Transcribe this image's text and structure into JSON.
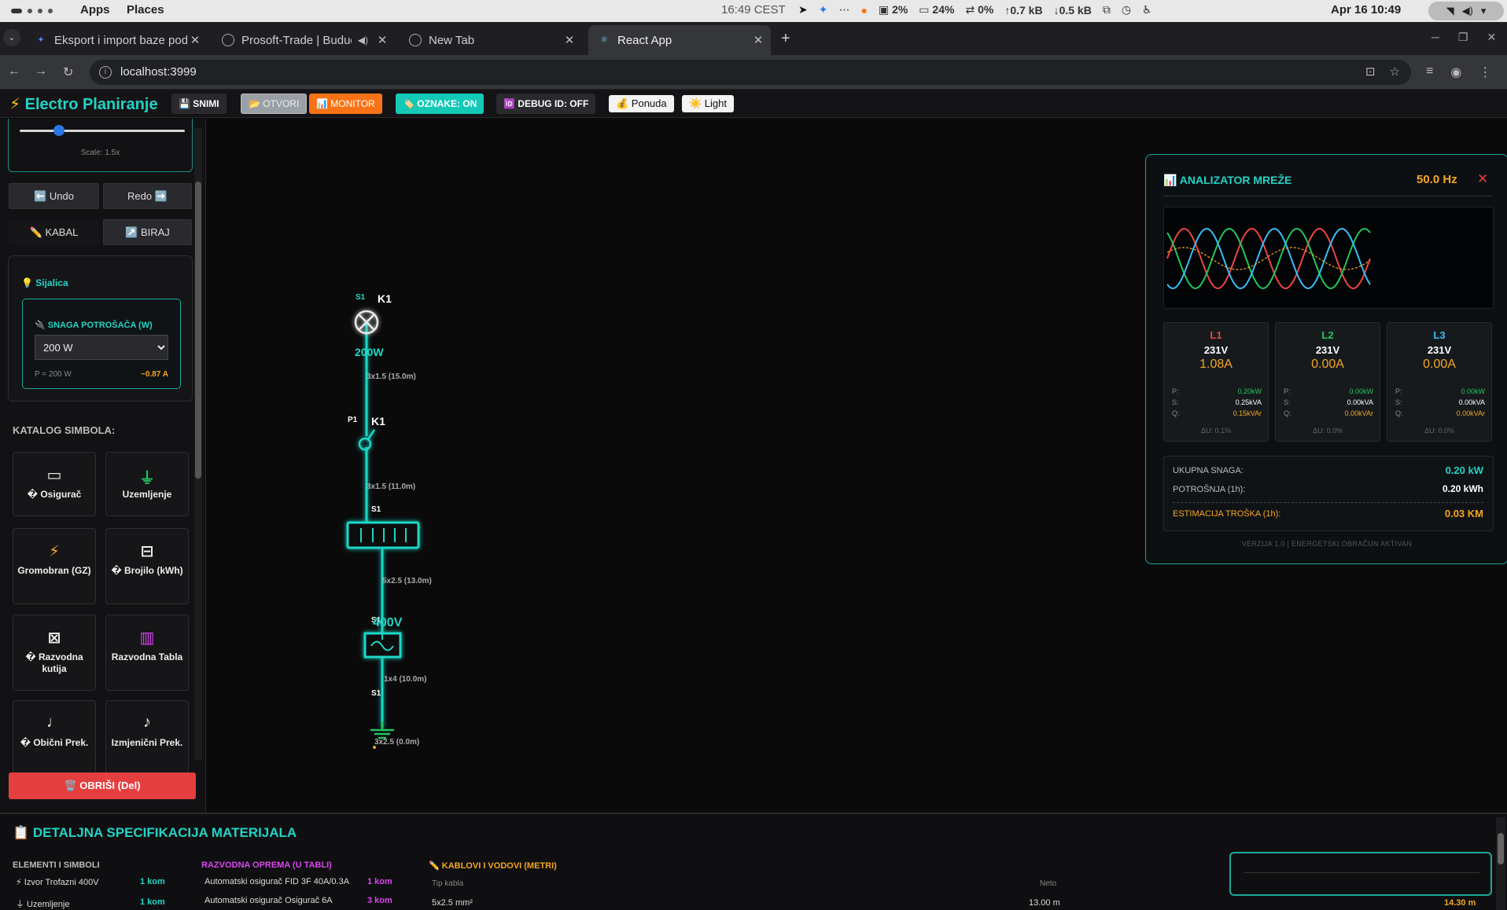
{
  "system": {
    "apps": "Apps",
    "places": "Places",
    "time_center": "16:49 CEST",
    "cpu": "2%",
    "mem": "24%",
    "swap": "0%",
    "net_up": "0.7 kB",
    "net_down": "0.5 kB",
    "datetime": "Apr 16  10:49"
  },
  "tabs": [
    {
      "title": "Eksport i import baze podataka",
      "icon_color": "#4a8af4",
      "icon": "sparkle-icon"
    },
    {
      "title": "Prosoft-Trade | Budući",
      "icon_color": "#888",
      "icon": "globe-icon"
    },
    {
      "title": "New Tab",
      "icon_color": "#888",
      "icon": "chrome-icon"
    },
    {
      "title": "React App",
      "icon_color": "#61dafb",
      "icon": "react-icon"
    }
  ],
  "address": {
    "url": "localhost:3999"
  },
  "app": {
    "brand": "Electro Planiranje",
    "toolbar": {
      "save": "💾 SNIMI",
      "open": "📂 OTVORI",
      "monitor": "📊 MONITOR",
      "labels": "🏷️ OZNAKE: ON",
      "debug": "🆔 DEBUG ID: OFF",
      "offer": "💰 Ponuda",
      "theme": "☀️ Light"
    },
    "accent": "#22d3c5"
  },
  "sidebar": {
    "scale_label": "Scale: 1.5x",
    "undo": "⬅️ Undo",
    "redo": "Redo ➡️",
    "cable": "✏️ KABAL",
    "select": "↗️ BIRAJ",
    "props": {
      "title": "💡 Sijalica",
      "power_label": "🔌 SNAGA POTROŠAČA (W)",
      "power_value": "200 W",
      "p_readout": "P = 200 W",
      "i_readout": "~0.87 A"
    },
    "catalog_title": "KATALOG SIMBOLA:",
    "catalog": [
      {
        "name": "� Osigurač",
        "sym": "▭",
        "color": "#fff"
      },
      {
        "name": "Uzemljenje",
        "sym": "⏚",
        "color": "#22c55e"
      },
      {
        "name": "Gromobran (GZ)",
        "sym": "⚡",
        "color": "#f5a623"
      },
      {
        "name": "� Brojilo (kWh)",
        "sym": "⊟",
        "color": "#fff"
      },
      {
        "name": "� Razvodna kutija",
        "sym": "⊠",
        "color": "#fff"
      },
      {
        "name": "Razvodna Tabla",
        "sym": "▥",
        "color": "#d946ef"
      },
      {
        "name": "� Obični Prek.",
        "sym": "♩",
        "color": "#fff"
      },
      {
        "name": "Izmjenični Prek.",
        "sym": "♪",
        "color": "#fff"
      }
    ],
    "delete": "🗑️ OBRIŠI (Del)"
  },
  "diagram": {
    "labels": {
      "s1_top": "S1",
      "k1_top": "K1",
      "power": "200W",
      "cable1": "3x1.5 (15.0m)",
      "p1": "P1",
      "k1_switch": "K1",
      "cable2": "3x1.5 (11.0m)",
      "s1_panel": "S1",
      "cable3": "5x2.5 (13.0m)",
      "s1_source": "S1",
      "source_v": "400V",
      "cable4": "1x4 (10.0m)",
      "s1_ground": "S1",
      "cable5": "3x2.5 (0.0m)"
    }
  },
  "analyzer": {
    "title": "📊 ANALIZATOR MREŽE",
    "freq": "50.0 Hz",
    "phases": [
      {
        "name": "L1",
        "color": "#ef4444",
        "v": "231V",
        "a": "1.08A",
        "p": "0.20kW",
        "s": "0.25kVA",
        "q": "0.15kVAr",
        "du": "ΔU: 0.1%"
      },
      {
        "name": "L2",
        "color": "#22c55e",
        "v": "231V",
        "a": "0.00A",
        "p": "0.00kW",
        "s": "0.00kVA",
        "q": "0.00kVAr",
        "du": "ΔU: 0.0%"
      },
      {
        "name": "L3",
        "color": "#38bdf8",
        "v": "231V",
        "a": "0.00A",
        "p": "0.00kW",
        "s": "0.00kVA",
        "q": "0.00kVAr",
        "du": "ΔU: 0.0%"
      }
    ],
    "row_labels": {
      "p": "P:",
      "s": "S:",
      "q": "Q:"
    },
    "total_label": "UKUPNA SNAGA:",
    "total_value": "0.20 kW",
    "consumption_label": "POTROŠNJA (1h):",
    "consumption_value": "0.20 kWh",
    "cost_label": "ESTIMACIJA TROŠKA (1h):",
    "cost_value": "0.03 KM",
    "version": "VERZIJA 1.0 | ENERGETSKI OBRAČUN AKTIVAN"
  },
  "spec": {
    "title": "📋 DETALJNA SPECIFIKACIJA MATERIJALA",
    "elements_title": "ELEMENTI I SIMBOLI",
    "elements": [
      {
        "name": "⚡ Izvor Trofazni 400V",
        "qty": "1 kom"
      },
      {
        "name": "⏚ Uzemljenje",
        "qty": "1 kom"
      }
    ],
    "panel_title": "RAZVODNA OPREMA (U TABLI)",
    "panel": [
      {
        "name": "Automatski osigurač FID 3F 40A/0.3A",
        "qty": "1 kom"
      },
      {
        "name": "Automatski osigurač Osigurač 6A",
        "qty": "3 kom"
      }
    ],
    "cables_title": "✏️ KABLOVI I VODOVI (METRI)",
    "cables_col_type": "Tip kabla",
    "cables_col_net": "Neto",
    "cables": [
      {
        "type": "5x2.5 mm²",
        "net": "13.00 m",
        "gross": "14.30 m"
      }
    ]
  }
}
